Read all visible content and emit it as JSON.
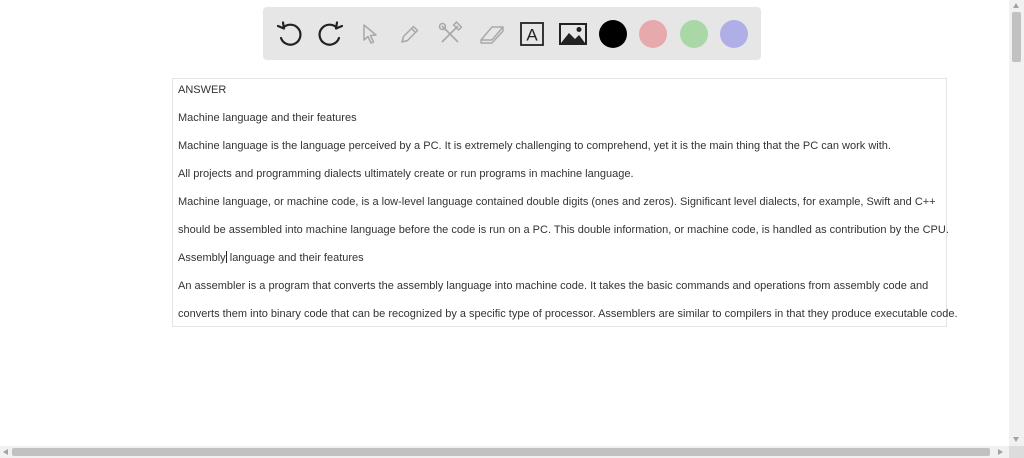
{
  "toolbar": {
    "tools": [
      {
        "name": "undo",
        "icon": "undo-icon"
      },
      {
        "name": "redo",
        "icon": "redo-icon"
      },
      {
        "name": "select",
        "icon": "cursor-arrow-icon"
      },
      {
        "name": "pen",
        "icon": "pencil-icon"
      },
      {
        "name": "tools",
        "icon": "hammer-wrench-icon"
      },
      {
        "name": "eraser",
        "icon": "eraser-icon"
      },
      {
        "name": "text",
        "icon": "text-box-icon",
        "glyph": "A"
      },
      {
        "name": "image",
        "icon": "image-icon"
      }
    ],
    "colors": [
      "#000000",
      "#e8a9ad",
      "#a9d8a6",
      "#b0aee6"
    ]
  },
  "document": {
    "lines": [
      "ANSWER",
      "Machine language and their features",
      "Machine language is the language perceived by a PC. It is extremely challenging to comprehend, yet it is the main thing that the PC can work with.",
      "All projects and programming dialects ultimately create or run programs in machine language.",
      "Machine language, or machine code, is a low-level language contained double digits (ones and zeros). Significant level dialects, for example, Swift and C++",
      "should be assembled into machine language before the code is run on a PC. This double information, or machine code, is handled as contribution by the CPU.",
      "Assembly language and their features",
      "An assembler is a program that converts the assembly language into machine code. It takes the basic commands and operations from assembly code and",
      "converts them into binary code that can be recognized by a specific type of processor. Assemblers are similar to compilers in that they produce executable code."
    ],
    "cursor_line": {
      "before": "Assembly",
      "after": " language and their features"
    }
  }
}
